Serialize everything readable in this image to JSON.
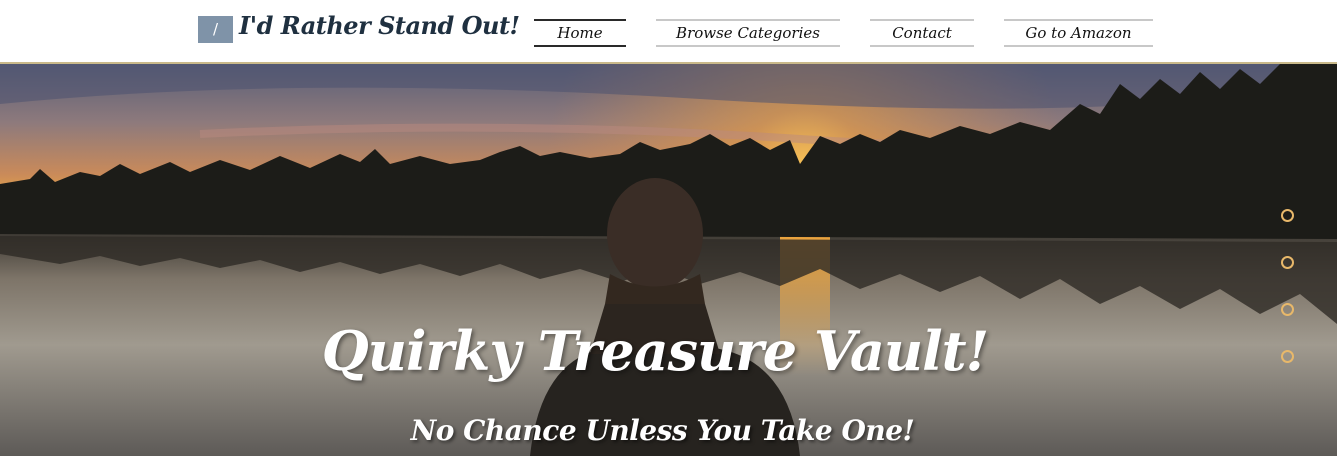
{
  "header": {
    "logo_glyph": "/",
    "site_title": "I'd Rather Stand Out!",
    "nav": [
      {
        "label": "Home",
        "active": true
      },
      {
        "label": "Browse Categories",
        "active": false
      },
      {
        "label": "Contact",
        "active": false
      },
      {
        "label": "Go to Amazon",
        "active": false
      }
    ]
  },
  "hero": {
    "title": "Quirky Treasure Vault!",
    "subtitle": "No Chance Unless You Take One!",
    "slide_count": 4
  },
  "colors": {
    "title_text": "#1f3040",
    "logo_box": "#7f93a8",
    "dot_accent": "#e8b86a"
  }
}
